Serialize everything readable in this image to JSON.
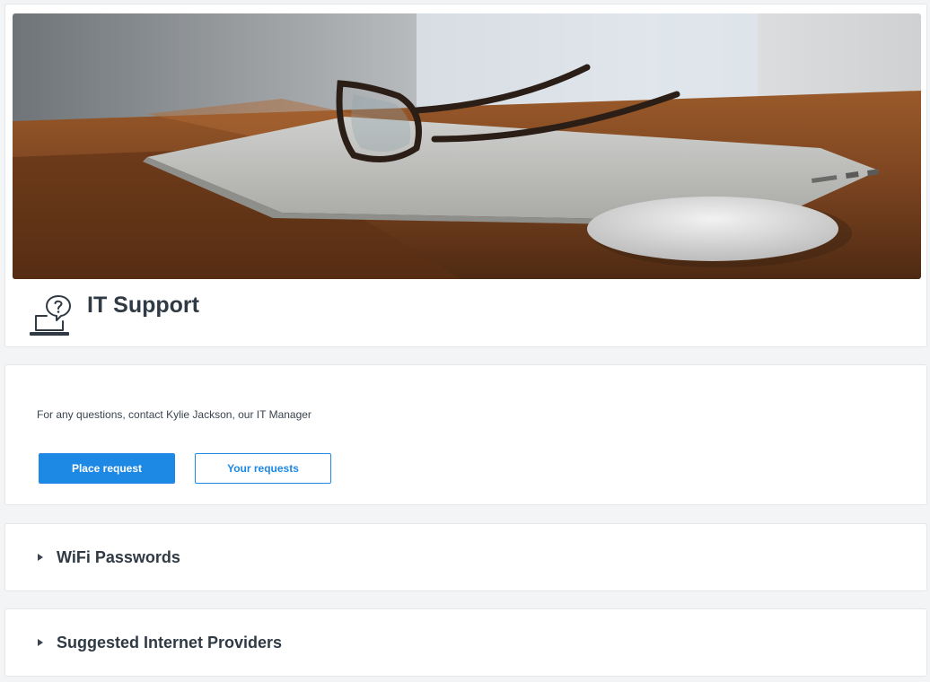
{
  "header": {
    "title": "IT Support",
    "banner_image": "laptop-glasses-mouse-on-desk",
    "icon": "laptop-question-icon"
  },
  "info": {
    "contact_text": "For any questions, contact Kylie Jackson, our IT Manager",
    "place_request_label": "Place request",
    "your_requests_label": "Your requests"
  },
  "sections": [
    {
      "label": "WiFi Passwords",
      "expanded": false
    },
    {
      "label": "Suggested Internet Providers",
      "expanded": false
    }
  ],
  "colors": {
    "primary": "#1e88e5",
    "background": "#f3f4f6",
    "text": "#2f3a45"
  }
}
